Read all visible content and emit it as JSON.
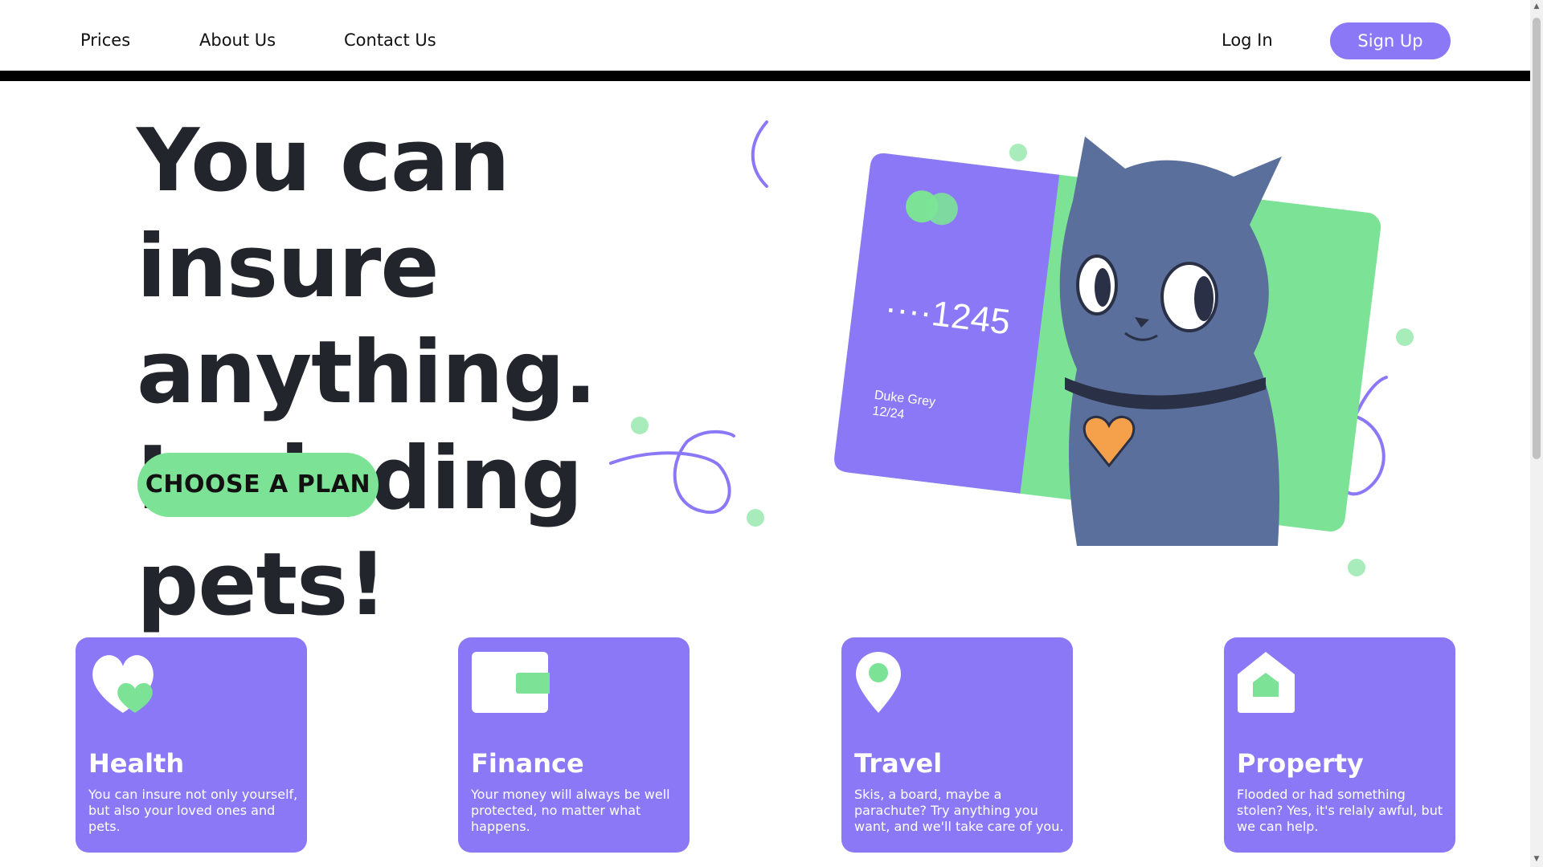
{
  "nav": {
    "links": [
      "Prices",
      "About Us",
      "Contact Us"
    ],
    "login": "Log In",
    "signup": "Sign Up"
  },
  "hero": {
    "lines": [
      "You can insure",
      "anything.",
      "Including pets!"
    ],
    "cta": "CHOOSE A PLAN",
    "card": {
      "number": "····1245",
      "holder": "Duke Grey",
      "expiry": "12/24"
    }
  },
  "features": [
    {
      "title": "Health",
      "text": "You can insure not only yourself, but also your loved ones and pets.",
      "icon": "heart-icon"
    },
    {
      "title": "Finance",
      "text": "Your money will always be well protected, no matter what happens.",
      "icon": "wallet-icon"
    },
    {
      "title": "Travel",
      "text": "Skis, a board, maybe a parachute? Try anything you want, and we'll take care of you.",
      "icon": "location-pin-icon"
    },
    {
      "title": "Property",
      "text": "Flooded or had something stolen? Yes, it's relaly awful, but we can help.",
      "icon": "house-icon"
    }
  ],
  "colors": {
    "accent": "#8b78f7",
    "green": "#7ce396",
    "text": "#22252b"
  }
}
